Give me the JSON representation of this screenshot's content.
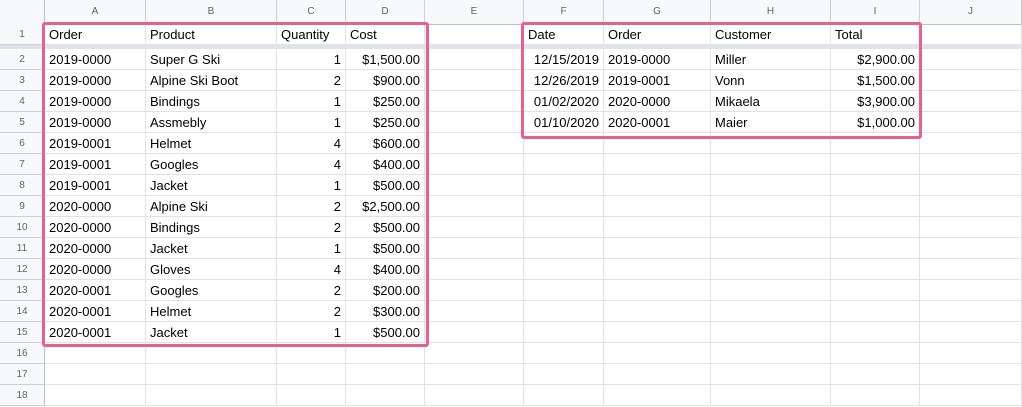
{
  "columns": [
    "A",
    "B",
    "C",
    "D",
    "E",
    "F",
    "G",
    "H",
    "I",
    "J"
  ],
  "rows": [
    "1",
    "2",
    "3",
    "4",
    "5",
    "6",
    "7",
    "8",
    "9",
    "10",
    "11",
    "12",
    "13",
    "14",
    "15",
    "16",
    "17",
    "18"
  ],
  "left_table": {
    "headers": [
      "Order",
      "Product",
      "Quantity",
      "Cost"
    ],
    "rows": [
      [
        "2019-0000",
        "Super G Ski",
        "1",
        "$1,500.00"
      ],
      [
        "2019-0000",
        "Alpine Ski Boot",
        "2",
        "$900.00"
      ],
      [
        "2019-0000",
        "Bindings",
        "1",
        "$250.00"
      ],
      [
        "2019-0000",
        "Assmebly",
        "1",
        "$250.00"
      ],
      [
        "2019-0001",
        "Helmet",
        "4",
        "$600.00"
      ],
      [
        "2019-0001",
        "Googles",
        "4",
        "$400.00"
      ],
      [
        "2019-0001",
        "Jacket",
        "1",
        "$500.00"
      ],
      [
        "2020-0000",
        "Alpine Ski",
        "2",
        "$2,500.00"
      ],
      [
        "2020-0000",
        "Bindings",
        "2",
        "$500.00"
      ],
      [
        "2020-0000",
        "Jacket",
        "1",
        "$500.00"
      ],
      [
        "2020-0000",
        "Gloves",
        "4",
        "$400.00"
      ],
      [
        "2020-0001",
        "Googles",
        "2",
        "$200.00"
      ],
      [
        "2020-0001",
        "Helmet",
        "2",
        "$300.00"
      ],
      [
        "2020-0001",
        "Jacket",
        "1",
        "$500.00"
      ]
    ]
  },
  "right_table": {
    "headers": [
      "Date",
      "Order",
      "Customer",
      "Total"
    ],
    "rows": [
      [
        "12/15/2019",
        "2019-0000",
        "Miller",
        "$2,900.00"
      ],
      [
        "12/26/2019",
        "2019-0001",
        "Vonn",
        "$1,500.00"
      ],
      [
        "01/02/2020",
        "2020-0000",
        "Mikaela",
        "$3,900.00"
      ],
      [
        "01/10/2020",
        "2020-0001",
        "Maier",
        "$1,000.00"
      ]
    ]
  },
  "colors": {
    "highlight": "#e8608d",
    "header_bg": "#f8f9fa",
    "gridline": "#e2e2e2"
  }
}
